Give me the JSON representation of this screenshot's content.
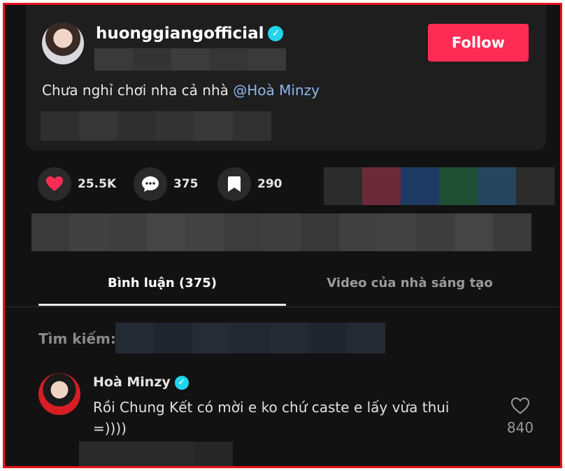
{
  "post": {
    "username": "huonggiangofficial",
    "follow_label": "Follow",
    "caption_text": "Chưa nghỉ chơi nha cả nhà ",
    "caption_mention": "@Hoà Minzy"
  },
  "stats": {
    "likes": "25.5K",
    "comments": "375",
    "saves": "290"
  },
  "tabs": [
    {
      "label": "Bình luận (375)",
      "active": true
    },
    {
      "label": "Video của nhà sáng tạo",
      "active": false
    }
  ],
  "search": {
    "label": "Tìm kiếm:"
  },
  "comment": {
    "author": "Hoà Minzy",
    "text": "Rồi Chung Kết có mời e ko chứ caste e lấy vừa thui =))))",
    "like_count": "840"
  },
  "colors": {
    "accent": "#fe2c55",
    "mention": "#8fb7ea",
    "verified": "#20d5ec",
    "border": "#e8141c"
  },
  "icons": {
    "like": "heart-icon",
    "comment": "comment-bubble-icon",
    "save": "bookmark-icon",
    "verified": "verified-badge-icon",
    "comment_like": "heart-outline-icon"
  }
}
